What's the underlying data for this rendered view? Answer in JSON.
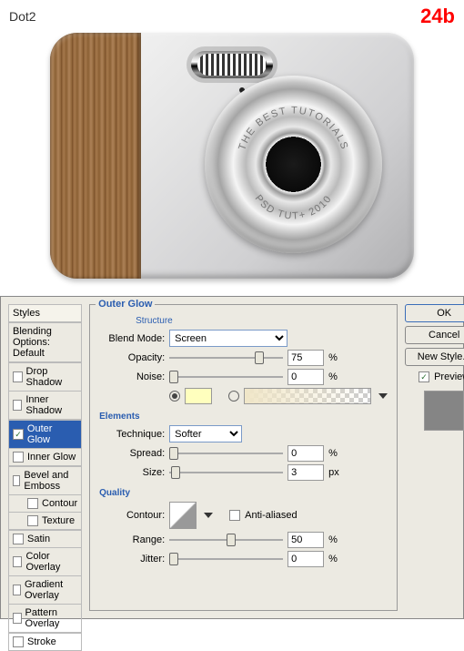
{
  "canvas": {
    "layer_name": "Dot2",
    "step_label": "24b",
    "lens_text_top": "THE BEST TUTORIALS",
    "lens_text_bottom": "PSD TUT+ 2010"
  },
  "dialog": {
    "styles_header": "Styles",
    "blending_header": "Blending Options: Default",
    "styles": [
      {
        "label": "Drop Shadow",
        "checked": false
      },
      {
        "label": "Inner Shadow",
        "checked": false
      },
      {
        "label": "Outer Glow",
        "checked": true,
        "selected": true
      },
      {
        "label": "Inner Glow",
        "checked": false
      },
      {
        "label": "Bevel and Emboss",
        "checked": false
      },
      {
        "label": "Contour",
        "checked": false,
        "indent": true
      },
      {
        "label": "Texture",
        "checked": false,
        "indent": true
      },
      {
        "label": "Satin",
        "checked": false
      },
      {
        "label": "Color Overlay",
        "checked": false
      },
      {
        "label": "Gradient Overlay",
        "checked": false
      },
      {
        "label": "Pattern Overlay",
        "checked": false
      },
      {
        "label": "Stroke",
        "checked": false
      }
    ],
    "section": "Outer Glow",
    "structure": {
      "title": "Structure",
      "blend_mode_label": "Blend Mode:",
      "blend_mode_value": "Screen",
      "opacity_label": "Opacity:",
      "opacity_value": "75",
      "opacity_unit": "%",
      "noise_label": "Noise:",
      "noise_value": "0",
      "noise_unit": "%",
      "color": "#ffffbe"
    },
    "elements": {
      "title": "Elements",
      "technique_label": "Technique:",
      "technique_value": "Softer",
      "spread_label": "Spread:",
      "spread_value": "0",
      "spread_unit": "%",
      "size_label": "Size:",
      "size_value": "3",
      "size_unit": "px"
    },
    "quality": {
      "title": "Quality",
      "contour_label": "Contour:",
      "antialiased_label": "Anti-aliased",
      "antialiased": false,
      "range_label": "Range:",
      "range_value": "50",
      "range_unit": "%",
      "jitter_label": "Jitter:",
      "jitter_value": "0",
      "jitter_unit": "%"
    },
    "buttons": {
      "ok": "OK",
      "cancel": "Cancel",
      "new_style": "New Style...",
      "preview": "Preview"
    },
    "preview_checked": true,
    "preview_color": "#858585"
  }
}
